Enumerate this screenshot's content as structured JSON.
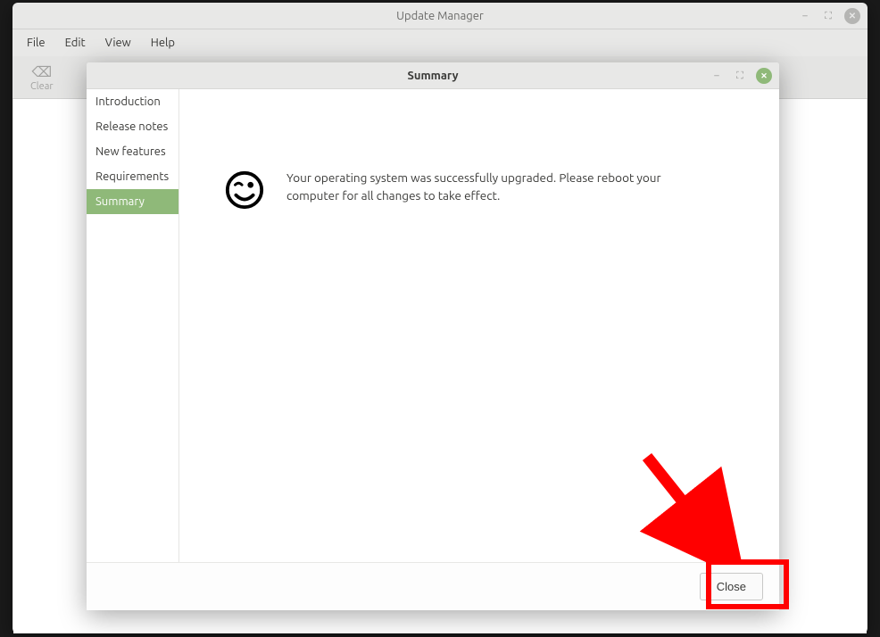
{
  "main_window": {
    "title": "Update Manager",
    "menubar": [
      "File",
      "Edit",
      "View",
      "Help"
    ],
    "toolbar": {
      "clear_label": "Clear"
    }
  },
  "dialog": {
    "title": "Summary",
    "sidebar_items": [
      {
        "label": "Introduction",
        "active": false
      },
      {
        "label": "Release notes",
        "active": false
      },
      {
        "label": "New features",
        "active": false
      },
      {
        "label": "Requirements",
        "active": false
      },
      {
        "label": "Summary",
        "active": true
      }
    ],
    "message": "Your operating system was successfully upgraded. Please reboot your computer for all changes to take effect.",
    "close_label": "Close"
  }
}
